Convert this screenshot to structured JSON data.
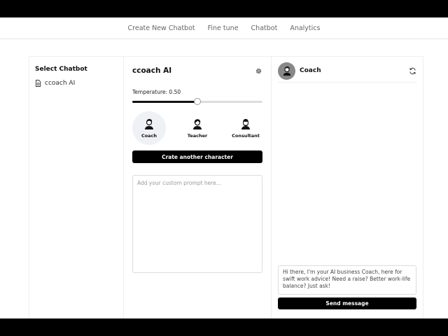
{
  "nav": {
    "items": [
      "Create New Chatbot",
      "Fine tune",
      "Chatbot",
      "Analytics"
    ]
  },
  "left_panel": {
    "title": "Select Chatbot",
    "bots": [
      {
        "label": "ccoach AI",
        "icon": "file-icon"
      }
    ]
  },
  "config": {
    "title": "ccoach AI",
    "settings_icon": "gear-icon",
    "temperature_label": "Temperature: 0.50",
    "temperature_value": 0.5,
    "characters": [
      {
        "label": "Coach",
        "icon": "coach-avatar-icon",
        "active": true
      },
      {
        "label": "Teacher",
        "icon": "teacher-avatar-icon",
        "active": false
      },
      {
        "label": "Consultant",
        "icon": "consultant-avatar-icon",
        "active": false
      }
    ],
    "create_button": "Crate another character",
    "prompt_placeholder": "Add your custom prompt here..."
  },
  "chat": {
    "name": "Coach",
    "refresh_icon": "refresh-icon",
    "message": "Hi there, I'm your AI business Coach, here for swift work advice! Need a raise? Better work-life balance? Just ask!",
    "send_button": "Send message"
  },
  "colors": {
    "primary": "#000000",
    "active_character_bg": "#eef1f6",
    "avatar_bg": "#888888"
  }
}
